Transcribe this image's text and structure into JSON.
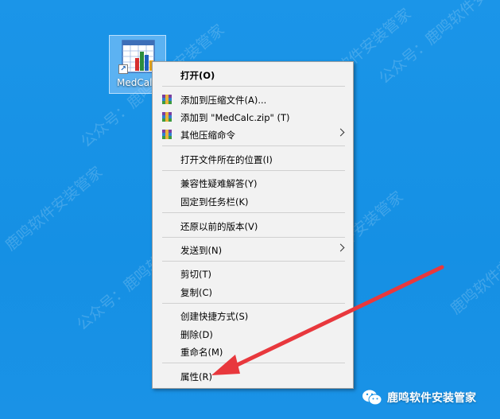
{
  "desktop": {
    "icon_label": "MedCalc",
    "watermark": "公众号：鹿鸣软件安装管家",
    "watermark_short": "鹿鸣软件安装管家"
  },
  "context_menu": {
    "items": [
      {
        "label": "打开(O)"
      },
      {
        "label": "添加到压缩文件(A)...",
        "icon": "winrar-icon"
      },
      {
        "label": "添加到 \"MedCalc.zip\" (T)",
        "icon": "winrar-icon"
      },
      {
        "label": "其他压缩命令",
        "icon": "winrar-icon"
      },
      {
        "label": "打开文件所在的位置(I)"
      },
      {
        "label": "兼容性疑难解答(Y)"
      },
      {
        "label": "固定到任务栏(K)"
      },
      {
        "label": "还原以前的版本(V)"
      },
      {
        "label": "发送到(N)"
      },
      {
        "label": "剪切(T)"
      },
      {
        "label": "复制(C)"
      },
      {
        "label": "创建快捷方式(S)"
      },
      {
        "label": "删除(D)"
      },
      {
        "label": "重命名(M)"
      },
      {
        "label": "属性(R)"
      }
    ]
  },
  "brand_badge": {
    "label": "鹿鸣软件安装管家",
    "icon": "wechat-icon"
  },
  "colors": {
    "desktop": "#1a93e6",
    "menu_bg": "#f2f2f2",
    "annotation_arrow": "#e8383d"
  }
}
